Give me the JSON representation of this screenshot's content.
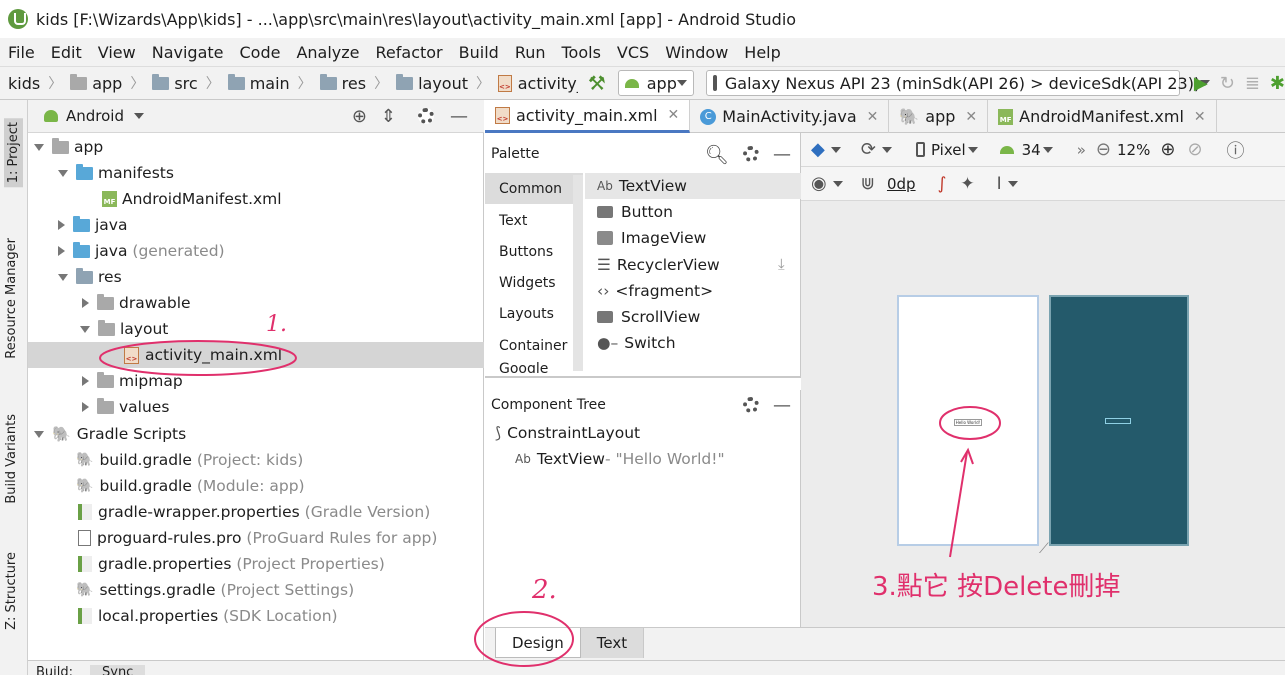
{
  "window": {
    "title": "kids [F:\\Wizards\\App\\kids] - ...\\app\\src\\main\\res\\layout\\activity_main.xml [app] - Android Studio"
  },
  "menu": [
    "File",
    "Edit",
    "View",
    "Navigate",
    "Code",
    "Analyze",
    "Refactor",
    "Build",
    "Run",
    "Tools",
    "VCS",
    "Window",
    "Help"
  ],
  "breadcrumb": [
    "kids",
    "app",
    "src",
    "main",
    "res",
    "layout",
    "activity_main.xml"
  ],
  "toolbar": {
    "config": "app",
    "device": "Galaxy Nexus API 23 (minSdk(API 26) > deviceSdk(API 23))"
  },
  "sidetabs": [
    "1: Project",
    "Resource Manager",
    "Build Variants",
    "Z: Structure"
  ],
  "project": {
    "view": "Android",
    "tree": [
      {
        "label": "app",
        "note": ""
      },
      {
        "label": "manifests",
        "note": ""
      },
      {
        "label": "AndroidManifest.xml",
        "note": ""
      },
      {
        "label": "java",
        "note": ""
      },
      {
        "label": "java",
        "note": "(generated)"
      },
      {
        "label": "res",
        "note": ""
      },
      {
        "label": "drawable",
        "note": ""
      },
      {
        "label": "layout",
        "note": ""
      },
      {
        "label": "activity_main.xml",
        "note": ""
      },
      {
        "label": "mipmap",
        "note": ""
      },
      {
        "label": "values",
        "note": ""
      },
      {
        "label": "Gradle Scripts",
        "note": ""
      },
      {
        "label": "build.gradle",
        "note": "(Project: kids)"
      },
      {
        "label": "build.gradle",
        "note": "(Module: app)"
      },
      {
        "label": "gradle-wrapper.properties",
        "note": "(Gradle Version)"
      },
      {
        "label": "proguard-rules.pro",
        "note": "(ProGuard Rules for app)"
      },
      {
        "label": "gradle.properties",
        "note": "(Project Properties)"
      },
      {
        "label": "settings.gradle",
        "note": "(Project Settings)"
      },
      {
        "label": "local.properties",
        "note": "(SDK Location)"
      }
    ]
  },
  "tabs": [
    "activity_main.xml",
    "MainActivity.java",
    "app",
    "AndroidManifest.xml"
  ],
  "palette": {
    "title": "Palette",
    "categories": [
      "Common",
      "Text",
      "Buttons",
      "Widgets",
      "Layouts",
      "Container",
      "Google"
    ],
    "items": [
      "TextView",
      "Button",
      "ImageView",
      "RecyclerView",
      "<fragment>",
      "ScrollView",
      "Switch"
    ]
  },
  "component_tree": {
    "title": "Component Tree",
    "root": "ConstraintLayout",
    "child": "TextView",
    "child_note": "- \"Hello World!\""
  },
  "design": {
    "device": "Pixel",
    "api": "34",
    "zoom": "12%",
    "margin": "0dp",
    "hello": "Hello World!"
  },
  "bottom_tabs": [
    "Design",
    "Text"
  ],
  "status": {
    "items": [
      "Build:",
      "Sync"
    ]
  },
  "annotations": {
    "a1": "1.",
    "a2": "2.",
    "a3": "3.點它 按Delete刪掉"
  },
  "colors": {
    "accent": "#e0306c",
    "blueprint": "#245a6b"
  }
}
